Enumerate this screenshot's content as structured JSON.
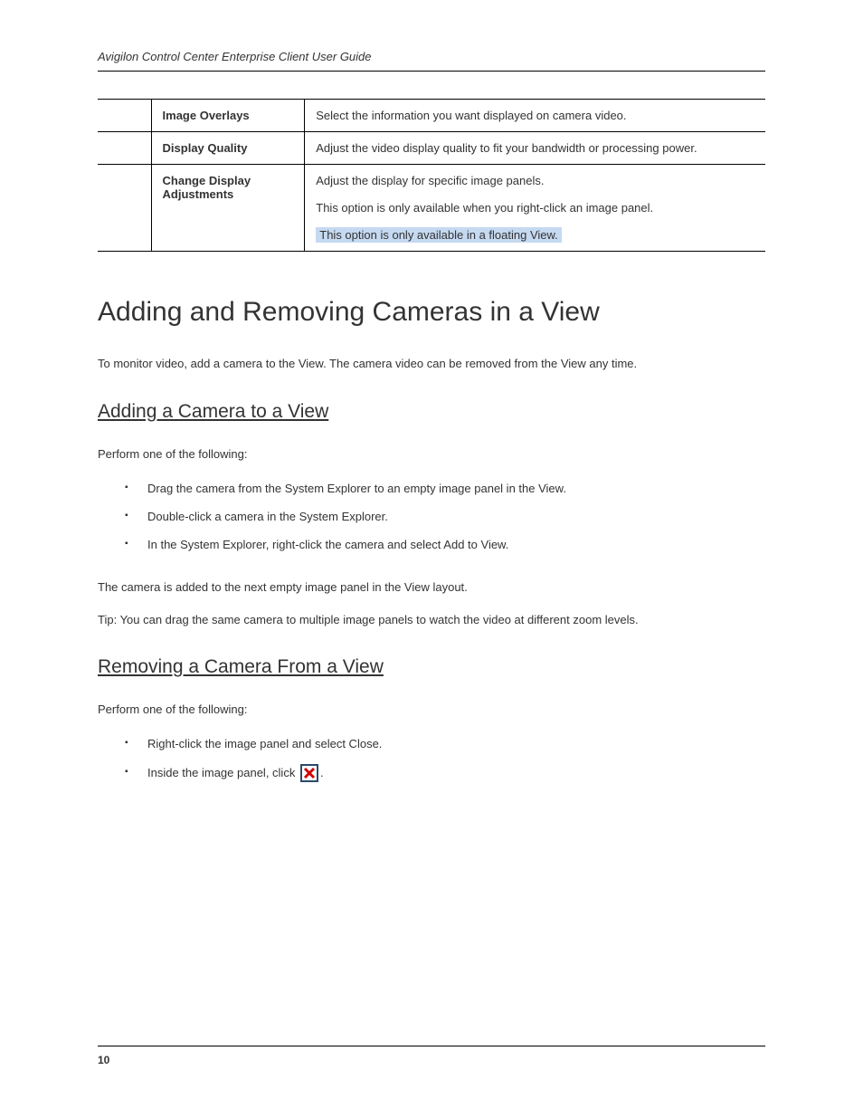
{
  "header": {
    "title": "Avigilon Control Center Enterprise Client User Guide"
  },
  "table": {
    "rows": [
      {
        "col1": "",
        "col2": "Image Overlays",
        "col3": "Select the information you want displayed on camera video."
      },
      {
        "col1": "",
        "col2": "Display Quality",
        "col3": "Adjust the video display quality to fit your bandwidth or processing power."
      },
      {
        "col1": "",
        "col2": "Change Display Adjustments",
        "col3_part1": "Adjust the display for specific image panels.",
        "col3_part2": "This option is only available when you right-click an image panel.",
        "col3_highlight": "This option is only available in a floating View."
      }
    ]
  },
  "sections": {
    "main_heading": "Adding and Removing Cameras in a View",
    "intro_text": "To monitor video, add a camera to the View. The camera video can be removed from the View any time.",
    "sub1_heading": "Adding a Camera to a View",
    "sub1_intro": "Perform one of the following:",
    "sub1_items": [
      "Drag the camera from the System Explorer to an empty image panel in the View.",
      "Double-click a camera in the System Explorer.",
      "In the System Explorer, right-click the camera and select Add to View."
    ],
    "sub1_footer1": "The camera is added to the next empty image panel in the View layout.",
    "sub1_tip": "Tip: You can drag the same camera to multiple image panels to watch the video at different zoom levels.",
    "sub2_heading": "Removing a Camera From a View",
    "sub2_intro": "Perform one of the following:",
    "sub2_items": [
      "Right-click the image panel and select Close.",
      "Inside the image panel, click "
    ],
    "sub2_item2_suffix": "."
  },
  "footer": {
    "page_number": "10"
  }
}
